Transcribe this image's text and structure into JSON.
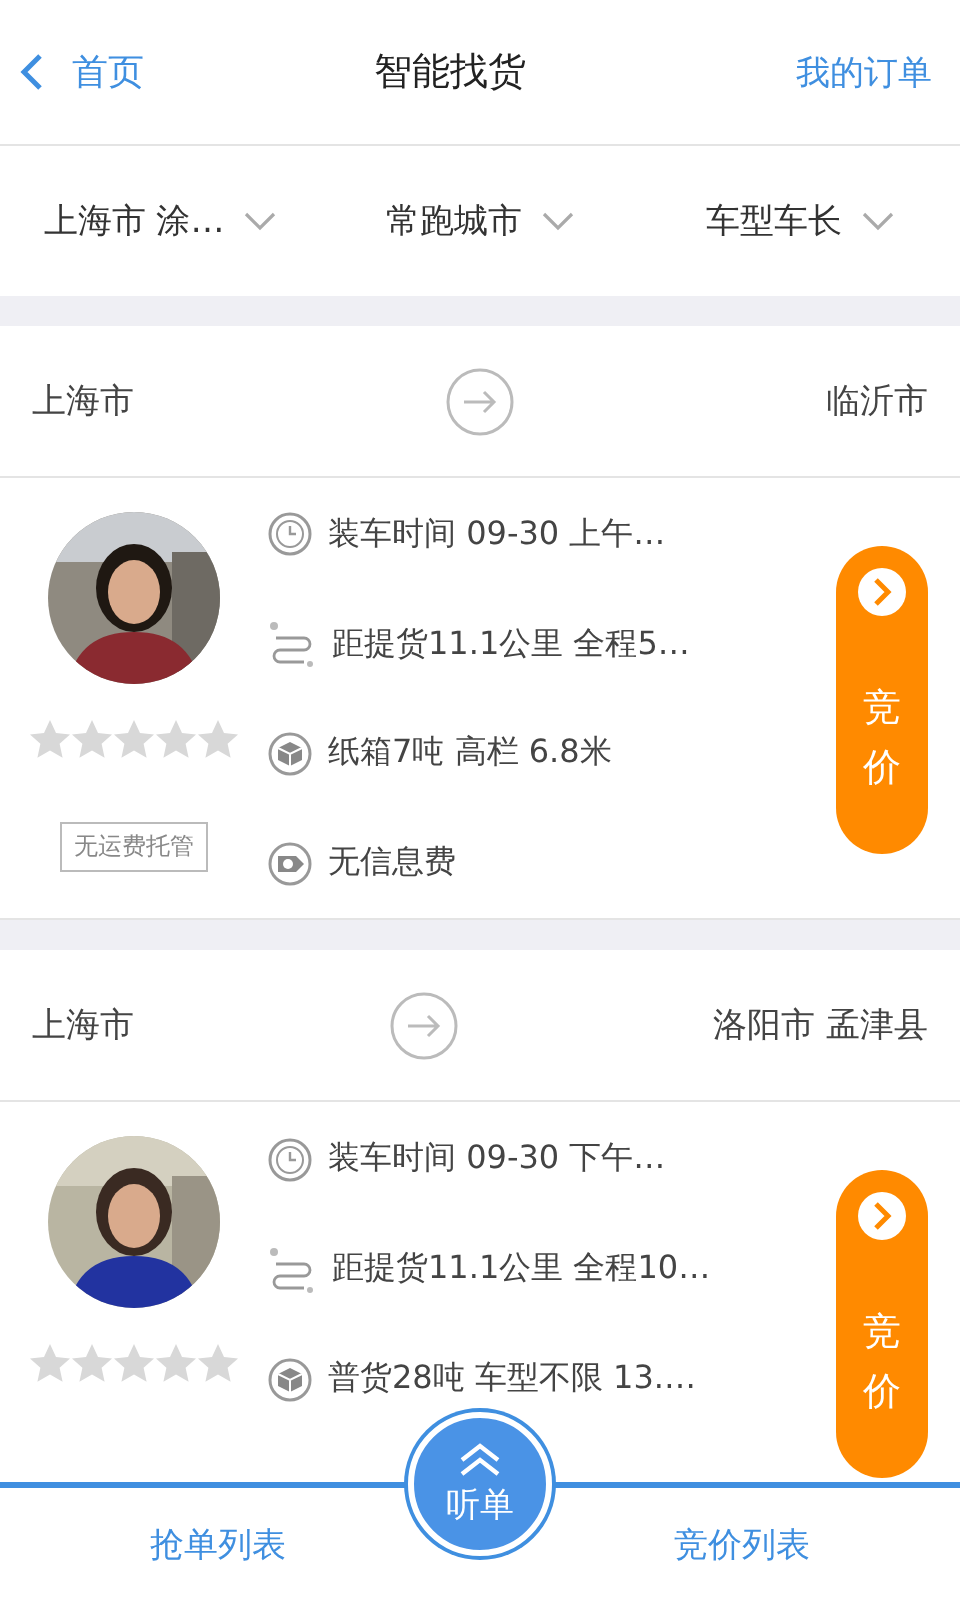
{
  "header": {
    "back_label": "首页",
    "title": "智能找货",
    "right_link": "我的订单"
  },
  "filters": [
    {
      "label": "上海市 涂…"
    },
    {
      "label": "常跑城市"
    },
    {
      "label": "车型车长"
    }
  ],
  "orders": [
    {
      "from": "上海市",
      "to": "临沂市",
      "stars": 0,
      "badge": "无运费托管",
      "action": "竞价",
      "rows": [
        {
          "kind": "clock",
          "text": "装车时间  09-30 上午…"
        },
        {
          "kind": "route",
          "text": "距提货11.1公里  全程5…"
        },
        {
          "kind": "box",
          "text": "纸箱7吨 高栏 6.8米"
        },
        {
          "kind": "fee",
          "text": "无信息费"
        }
      ]
    },
    {
      "from": "上海市",
      "to": "洛阳市 孟津县",
      "stars": 0,
      "action": "竞价",
      "rows": [
        {
          "kind": "clock",
          "text": "装车时间  09-30 下午…"
        },
        {
          "kind": "route",
          "text": "距提货11.1公里  全程10…"
        },
        {
          "kind": "box",
          "text": "普货28吨 车型不限 13.…"
        }
      ]
    }
  ],
  "bottom_bar": {
    "left": "抢单列表",
    "center": "听单",
    "right": "竞价列表"
  }
}
